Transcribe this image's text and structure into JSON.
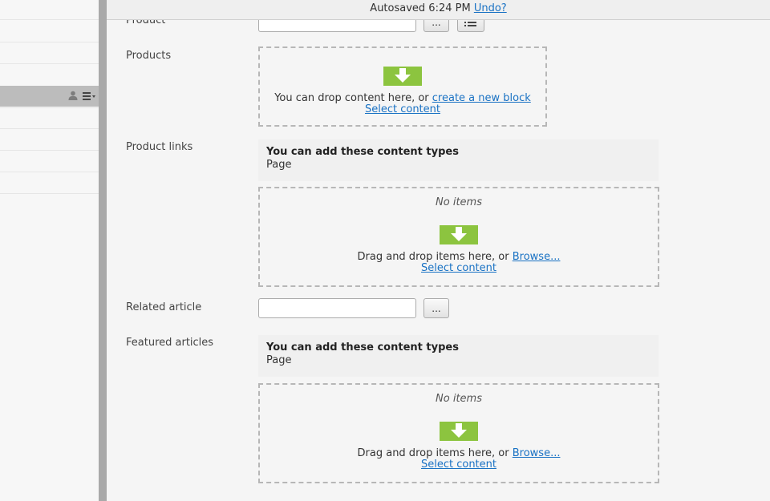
{
  "topbar": {
    "autosaved": "Autosaved 6:24 PM",
    "undo": "Undo?"
  },
  "fields": {
    "product": {
      "label": "Product",
      "browse_label": "..."
    },
    "products": {
      "label": "Products",
      "drop_text": "You can drop content here, or",
      "create_link": "create a new block",
      "select_link": "Select content"
    },
    "product_links": {
      "label": "Product links",
      "types_title": "You can add these content types",
      "types_item": "Page",
      "no_items": "No items",
      "drop_text": "Drag and drop items here, or",
      "browse_link": "Browse...",
      "select_link": "Select content"
    },
    "related_article": {
      "label": "Related article",
      "browse_label": "..."
    },
    "featured_articles": {
      "label": "Featured articles",
      "types_title": "You can add these content types",
      "types_item": "Page",
      "no_items": "No items",
      "drop_text": "Drag and drop items here, or",
      "browse_link": "Browse...",
      "select_link": "Select content"
    }
  },
  "colors": {
    "accent_green": "#8cc43f",
    "link_blue": "#1a72c4"
  },
  "icons": [
    "user-icon",
    "menu-icon",
    "list-icon",
    "drop-arrow-icon"
  ]
}
